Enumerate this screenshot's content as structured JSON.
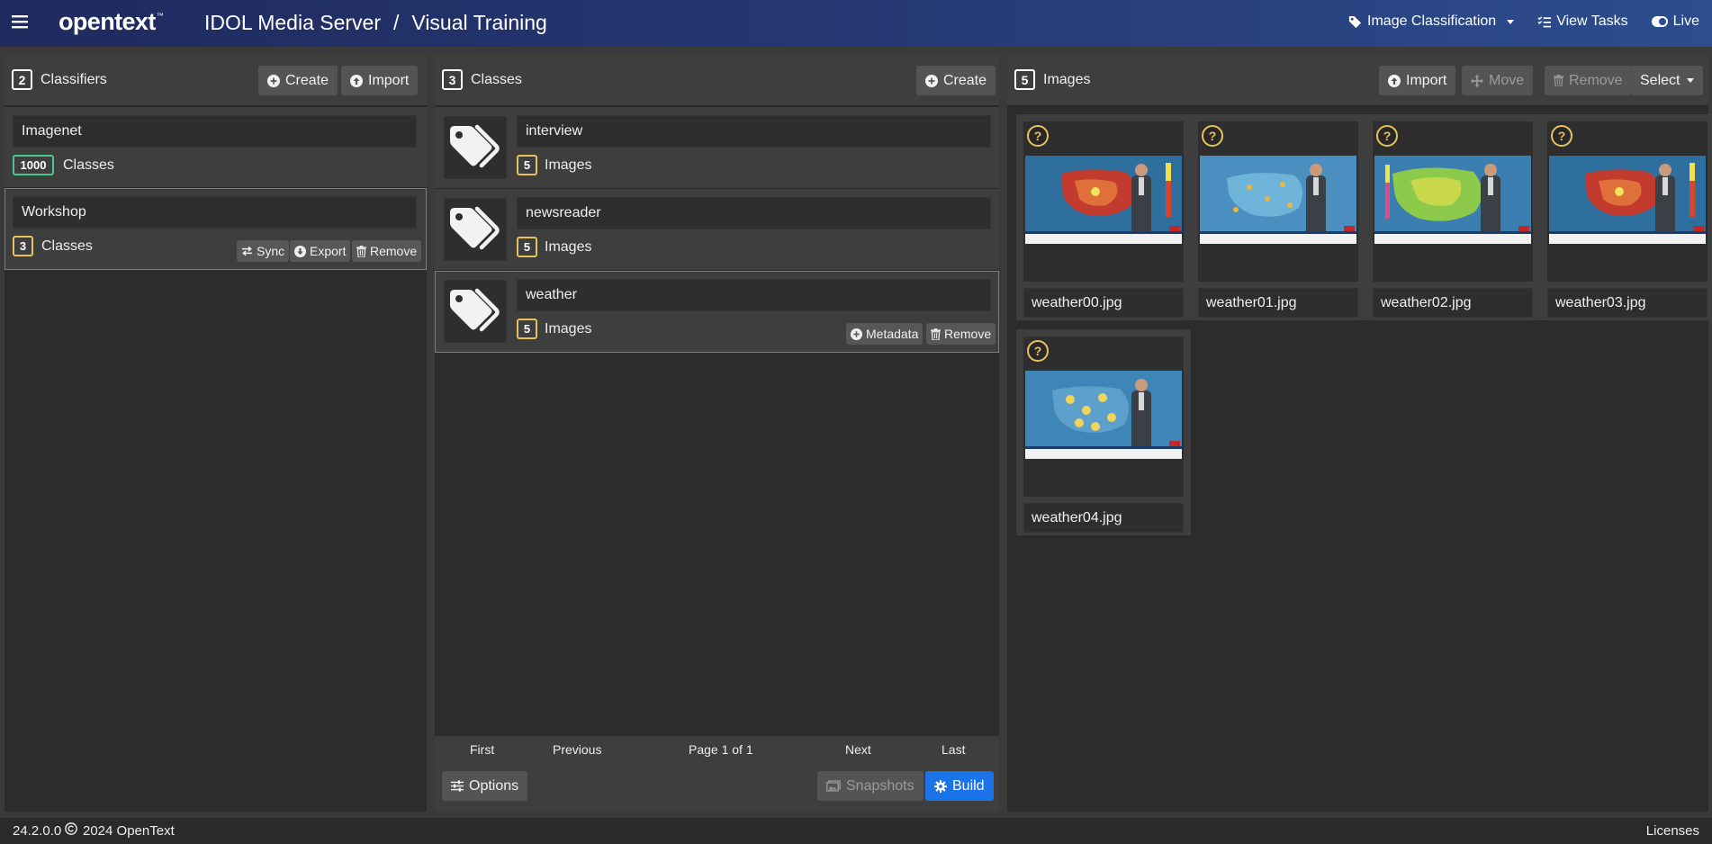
{
  "header": {
    "brand": "opentext",
    "brand_tm": "™",
    "product": "IDOL Media Server",
    "separator": "/",
    "page": "Visual Training",
    "mode": "Image Classification",
    "view_tasks": "View Tasks",
    "live": "Live"
  },
  "classifiers": {
    "count": "2",
    "title": "Classifiers",
    "create": "Create",
    "import": "Import",
    "items": [
      {
        "name": "Imagenet",
        "count": "1000",
        "unit": "Classes"
      },
      {
        "name": "Workshop",
        "count": "3",
        "unit": "Classes",
        "sync": "Sync",
        "export": "Export",
        "remove": "Remove"
      }
    ]
  },
  "classes": {
    "count": "3",
    "title": "Classes",
    "create": "Create",
    "items": [
      {
        "name": "interview",
        "count": "5",
        "unit": "Images"
      },
      {
        "name": "newsreader",
        "count": "5",
        "unit": "Images"
      },
      {
        "name": "weather",
        "count": "5",
        "unit": "Images",
        "metadata": "Metadata",
        "remove": "Remove"
      }
    ],
    "pager": {
      "first": "First",
      "previous": "Previous",
      "page": "Page 1 of 1",
      "next": "Next",
      "last": "Last"
    },
    "options": "Options",
    "snapshots": "Snapshots",
    "build": "Build"
  },
  "images": {
    "count": "5",
    "title": "Images",
    "import": "Import",
    "move": "Move",
    "remove": "Remove",
    "select": "Select",
    "unknown_mark": "?",
    "items": [
      {
        "name": "weather00.jpg",
        "map": "temperature-map"
      },
      {
        "name": "weather01.jpg",
        "map": "sea-map"
      },
      {
        "name": "weather02.jpg",
        "map": "pressure-map"
      },
      {
        "name": "weather03.jpg",
        "map": "temperature-map"
      },
      {
        "name": "weather04.jpg",
        "map": "clouds-map"
      }
    ]
  },
  "footer": {
    "version": "24.2.0.0",
    "copyright": "2024 OpenText",
    "licenses": "Licenses"
  },
  "colors": {
    "build_button": "#1a73e8",
    "badge_yellow": "#e7c35a",
    "badge_green": "#4cc78f",
    "selection_border": "#7a6fd8"
  }
}
